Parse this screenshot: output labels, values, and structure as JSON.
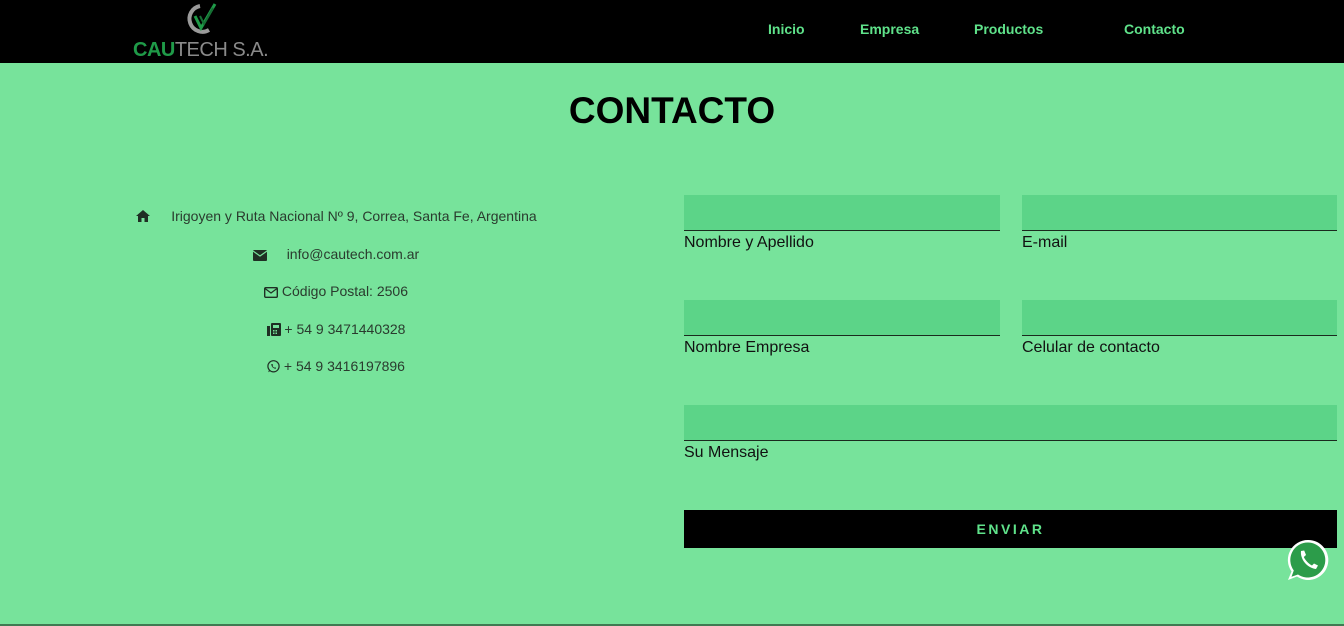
{
  "header": {
    "logo": {
      "text_primary": "CAU",
      "text_secondary": "TECH S.A.",
      "icon": "cautech-logo-mark"
    },
    "nav": [
      {
        "label": "Inicio"
      },
      {
        "label": "Empresa"
      },
      {
        "label": "Productos"
      },
      {
        "label": "Contacto"
      }
    ]
  },
  "page": {
    "title": "CONTACTO"
  },
  "contact_info": [
    {
      "icon": "home-icon",
      "text": "Irigoyen y Ruta Nacional Nº 9, Correa, Santa Fe, Argentina"
    },
    {
      "icon": "envelope-icon",
      "text": "info@cautech.com.ar"
    },
    {
      "icon": "envelope-outline-icon",
      "text": " Código Postal: 2506"
    },
    {
      "icon": "fax-icon",
      "text": " + 54 9 3471440328"
    },
    {
      "icon": "whatsapp-icon",
      "text": " + 54 9 3416197896"
    }
  ],
  "form": {
    "fields": [
      {
        "label": "Nombre y Apellido",
        "value": ""
      },
      {
        "label": "E-mail",
        "value": ""
      },
      {
        "label": "Nombre Empresa",
        "value": ""
      },
      {
        "label": "Celular de contacto",
        "value": ""
      },
      {
        "label": "Su Mensaje",
        "value": ""
      }
    ],
    "submit_label": "ENVIAR"
  },
  "floating": {
    "icon": "whatsapp-icon"
  },
  "colors": {
    "background": "#77e39b",
    "header": "#000000",
    "accent": "#5fe28a",
    "field": "#5cd488",
    "logo_green": "#1f9a48"
  }
}
